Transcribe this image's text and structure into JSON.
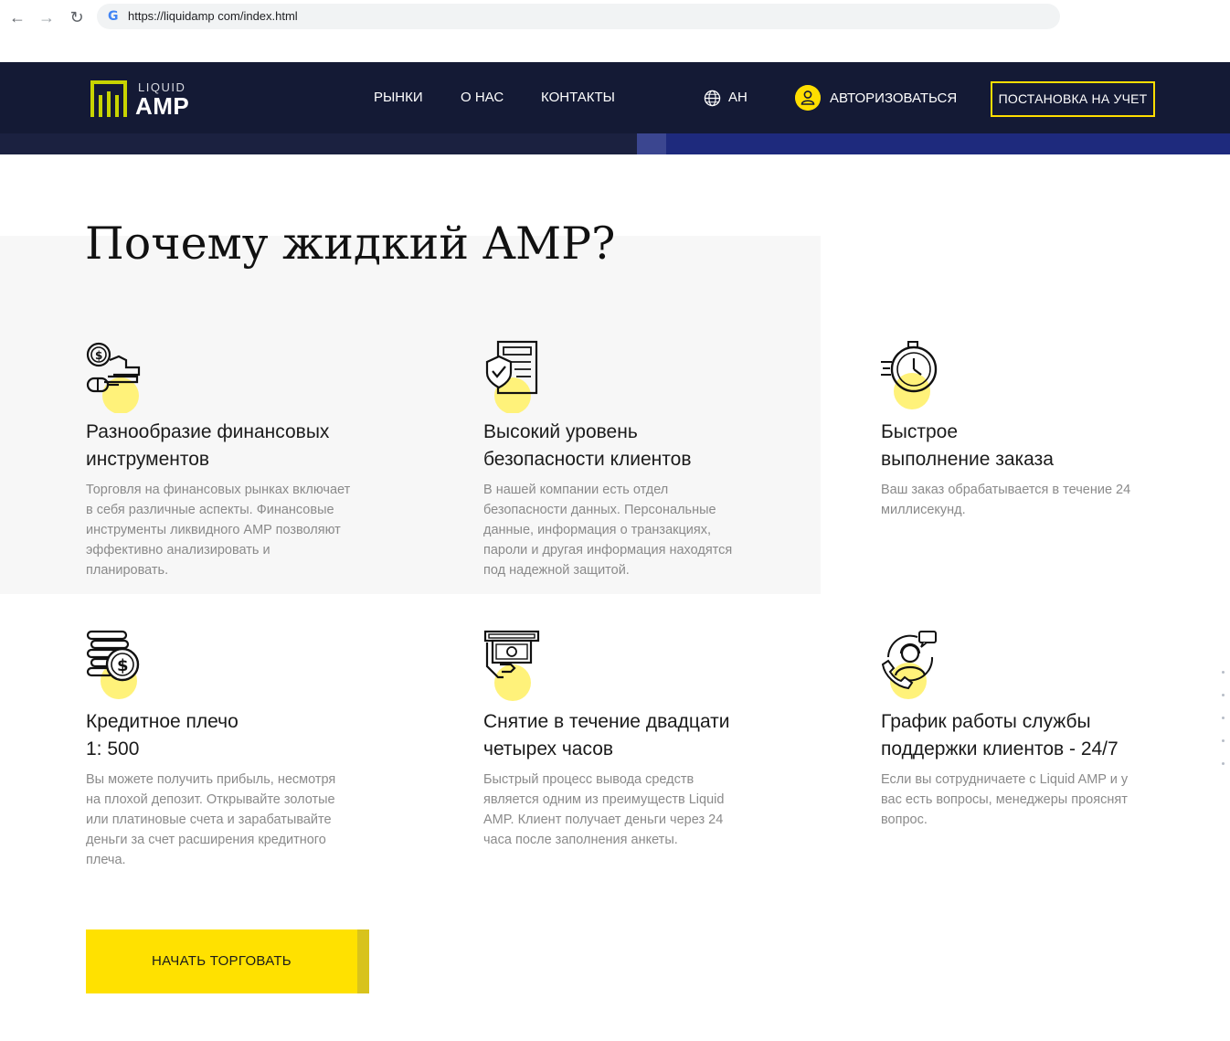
{
  "browser": {
    "url": "https://liquidamp com/index.html"
  },
  "header": {
    "logo_top": "LIQUID",
    "logo_bottom": "AMP",
    "menu": [
      "РЫНКИ",
      "О НАС",
      "КОНТАКТЫ"
    ],
    "language": "АН",
    "login_label": "АВТОРИЗОВАТЬСЯ",
    "register_label": "ПОСТАНОВКА НА УЧЕТ"
  },
  "main": {
    "title": "Почему жидкий AMP?",
    "features": [
      {
        "icon": "finance-money-icon",
        "title_line1": "Разнообразие финансовых",
        "title_line2": "инструментов",
        "text": "Торговля на финансовых рынках включает в себя различные аспекты. Финансовые инструменты ликвидного AMP позволяют эффективно анализировать и планировать."
      },
      {
        "icon": "security-shield-icon",
        "title_line1": "Высокий уровень",
        "title_line2": "безопасности клиентов",
        "text": "В нашей компании есть отдел безопасности данных. Персональные данные, информация о транзакциях, пароли и другая информация находятся под надежной защитой."
      },
      {
        "icon": "stopwatch-icon",
        "title_line1": "Быстрое",
        "title_line2": "выполнение заказа",
        "text": "Ваш заказ обрабатывается в течение 24 миллисекунд."
      },
      {
        "icon": "coins-stack-icon",
        "title_line1": "Кредитное плечо",
        "title_line2": "1: 500",
        "text": "Вы можете получить прибыль, несмотря на плохой депозит. Открывайте золотые или платиновые счета и зарабатывайте деньги за счет расширения кредитного плеча."
      },
      {
        "icon": "cash-withdrawal-icon",
        "title_line1": "Снятие в течение двадцати",
        "title_line2": "четырех часов",
        "text": "Быстрый процесс вывода средств является одним из преимуществ Liquid AMP. Клиент получает деньги через 24 часа после заполнения анкеты."
      },
      {
        "icon": "support-agent-icon",
        "title_line1": "График работы службы",
        "title_line2": "поддержки клиентов - 24/7",
        "text": "Если вы сотрудничаете с Liquid AMP и у вас есть вопросы, менеджеры прояснят вопрос."
      }
    ],
    "cta_label": "НАЧАТЬ ТОРГОВАТЬ"
  },
  "colors": {
    "accent": "#ffe100",
    "header_bg": "#141a35",
    "panel_bg": "#f7f7f7"
  }
}
